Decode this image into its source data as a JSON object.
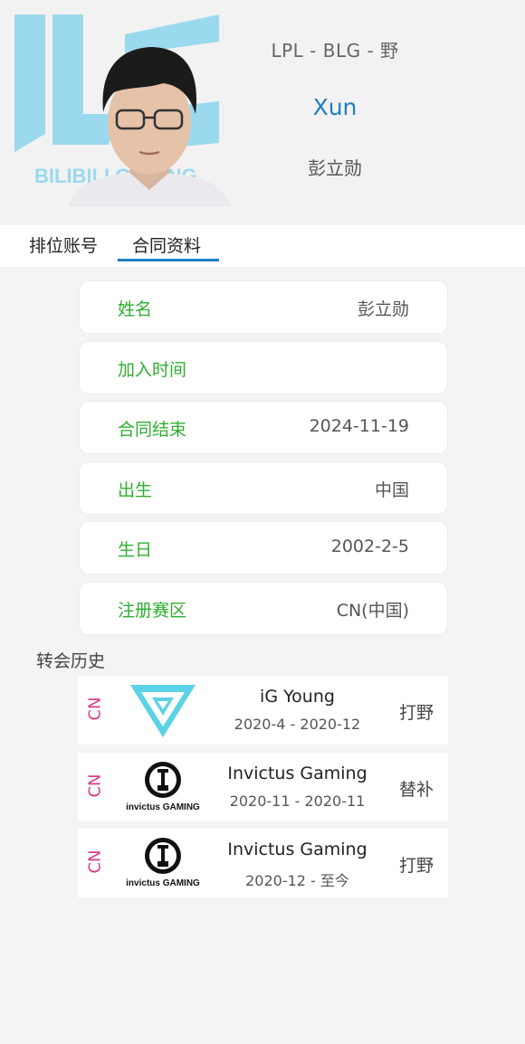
{
  "header": {
    "league_line": "LPL - BLG - 野",
    "nickname": "Xun",
    "real_name": "彭立勋",
    "team_logo_text": "BILIBILI GAMING",
    "accent_color": "#1d7fc4"
  },
  "tabs": [
    {
      "label": "排位账号",
      "active": false
    },
    {
      "label": "合同资料",
      "active": true
    }
  ],
  "contract_info": [
    {
      "label": "姓名",
      "value": "彭立勋"
    },
    {
      "label": "加入时间",
      "value": ""
    },
    {
      "label": "合同结束",
      "value": "2024-11-19"
    },
    {
      "label": "出生",
      "value": "中国"
    },
    {
      "label": "生日",
      "value": "2002-2-5"
    },
    {
      "label": "注册赛区",
      "value": "CN(中国)"
    }
  ],
  "label_color": "#2fae2f",
  "history": {
    "title": "转会历史",
    "transfers": [
      {
        "region": "CN",
        "team": "iG Young",
        "period": "2020-4 - 2020-12",
        "role": "打野",
        "logo_icon": "ig-young-logo"
      },
      {
        "region": "CN",
        "team": "Invictus Gaming",
        "period": "2020-11 - 2020-11",
        "role": "替补",
        "logo_icon": "invictus-gaming-logo"
      },
      {
        "region": "CN",
        "team": "Invictus Gaming",
        "period": "2020-12 - 至今",
        "role": "打野",
        "logo_icon": "invictus-gaming-logo"
      }
    ],
    "ig_logo_text": "invictus GAMING",
    "region_color": "#d63c86"
  }
}
